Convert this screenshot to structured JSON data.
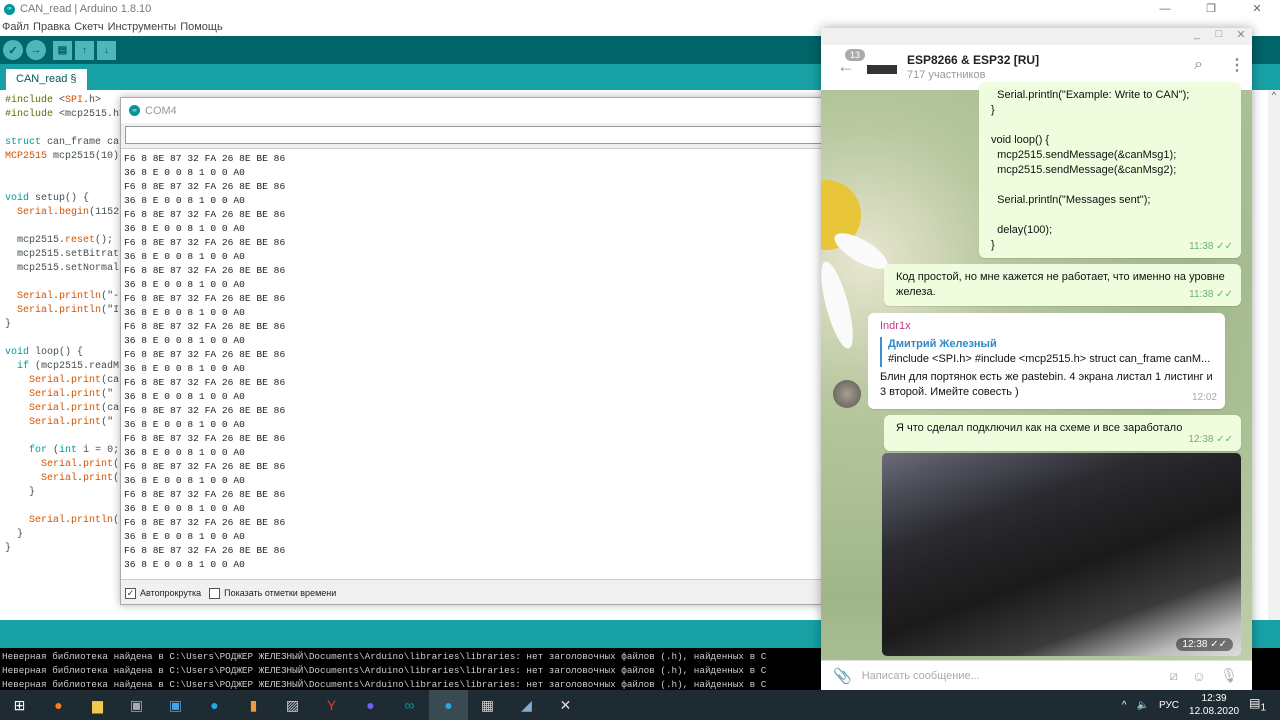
{
  "arduino": {
    "title": "CAN_read | Arduino 1.8.10",
    "menu": [
      "Файл",
      "Правка",
      "Скетч",
      "Инструменты",
      "Помощь"
    ],
    "tab": "CAN_read §",
    "code": [
      "#include <SPI.h>",
      "#include <mcp2515.h>",
      "",
      "struct can_frame ca",
      "MCP2515 mcp2515(10)",
      "",
      "",
      "void setup() {",
      "  Serial.begin(1152",
      "",
      "  mcp2515.reset();",
      "  mcp2515.setBitrat",
      "  mcp2515.setNormal",
      "",
      "  Serial.println(\"-",
      "  Serial.println(\"I",
      "}",
      "",
      "void loop() {",
      "  if (mcp2515.readM",
      "    Serial.print(ca",
      "    Serial.print(\" ",
      "    Serial.print(ca",
      "    Serial.print(\" ",
      "",
      "    for (int i = 0;",
      "      Serial.print(",
      "      Serial.print(",
      "    }",
      "",
      "    Serial.println(",
      "  }",
      "}"
    ],
    "console": [
      "Неверная библиотека найдена в C:\\Users\\РОДЖЕР ЖЕЛЕЗНЫЙ\\Documents\\Arduino\\libraries\\libraries: нет заголовочных файлов (.h), найденных в C",
      "Неверная библиотека найдена в C:\\Users\\РОДЖЕР ЖЕЛЕЗНЫЙ\\Documents\\Arduino\\libraries\\libraries: нет заголовочных файлов (.h), найденных в C",
      "Неверная библиотека найдена в C:\\Users\\РОДЖЕР ЖЕЛЕЗНЫЙ\\Documents\\Arduino\\libraries\\libraries: нет заголовочных файлов (.h), найденных в C"
    ]
  },
  "serial": {
    "title": "COM4",
    "line_a": "F6 8 8E 87 32 FA 26 8E BE 86",
    "line_b": "36 8 E 0 0 8 1 0 0 A0",
    "pairs": 15,
    "autoscroll_label": "Автопрокрутка",
    "autoscroll": true,
    "timestamps_label": "Показать отметки времени",
    "timestamps": false
  },
  "telegram": {
    "unread": "13",
    "group": "ESP8266 & ESP32 [RU]",
    "members": "717 участников",
    "messages": [
      {
        "text": "  Serial.println(\"Example: Write to CAN\");\n}\n\nvoid loop() {\n  mcp2515.sendMessage(&canMsg1);\n  mcp2515.sendMessage(&canMsg2);\n\n  Serial.println(\"Messages sent\");\n\n  delay(100);\n}",
        "time": "11:38"
      },
      {
        "text": "Код простой, но мне кажется не работает, что именно на уровне железа.",
        "time": "11:38"
      },
      {
        "author": "Indr1x",
        "quote_author": "Дмитрий Железный",
        "quote_text": "#include <SPI.h> #include <mcp2515.h>  struct can_frame canM...",
        "text": "Блин для портянок есть же pastebin. 4 экрана листал 1 листинг и 3 второй. Имейте совесть )",
        "time": "12:02"
      },
      {
        "text": "Я что сделал подключил как на схеме и все заработало",
        "time": "12:38"
      },
      {
        "time": "12:38"
      }
    ],
    "input_placeholder": "Написать сообщение..."
  },
  "taskbar": {
    "lang": "РУС",
    "time": "12:39",
    "date": "12.08.2020",
    "notifications": "1"
  }
}
